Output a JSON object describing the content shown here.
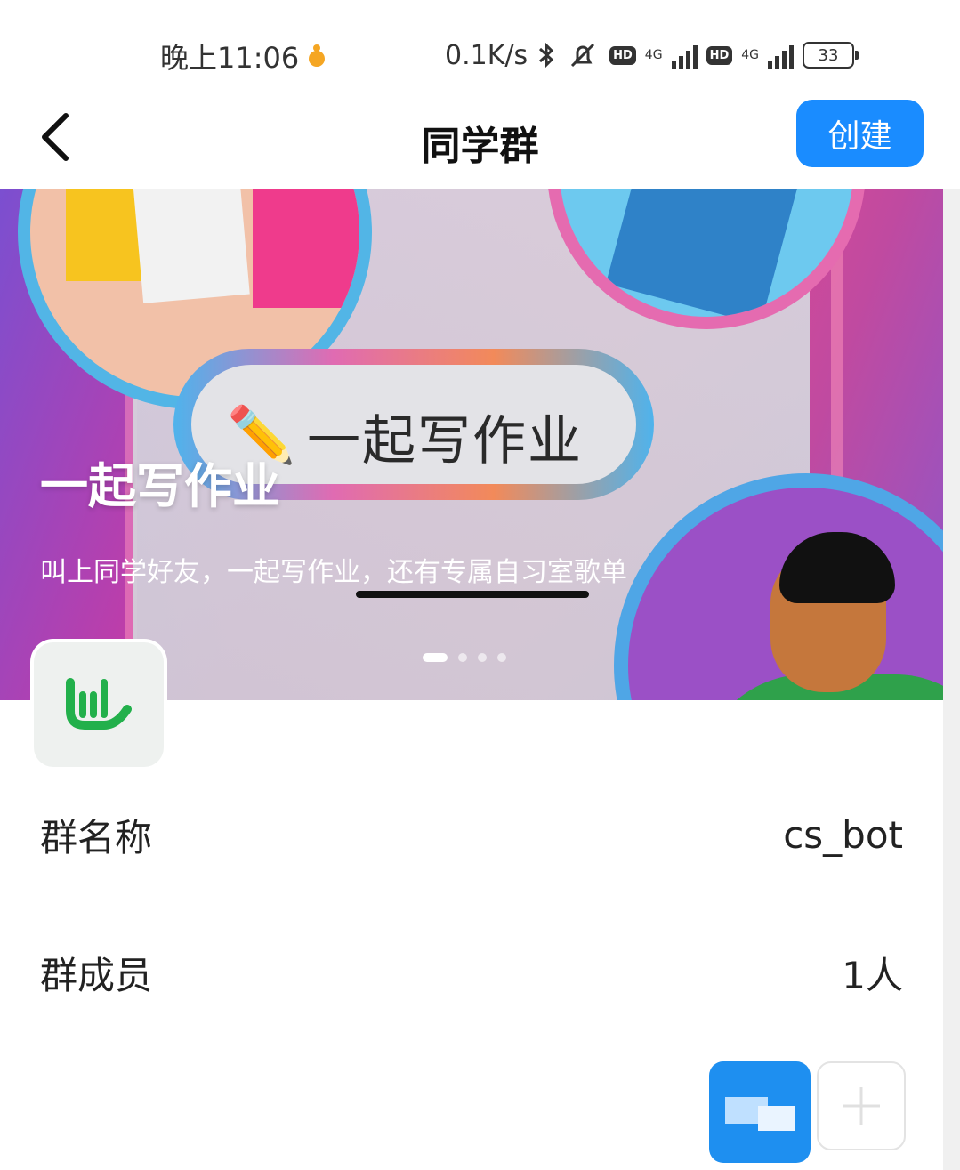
{
  "status_bar": {
    "time": "晚上11:06",
    "speed": "0.1K/s",
    "hd_label": "HD",
    "network": "4G",
    "battery": "33"
  },
  "header": {
    "title": "同学群",
    "create_label": "创建"
  },
  "banner": {
    "title": "一起写作业",
    "subtitle": "叫上同学好友，一起写作业，还有专属自习室歌单",
    "pill_text": "一起写作业",
    "dot_count": 4,
    "active_dot": 1
  },
  "group": {
    "name_label": "群名称",
    "name_value": "cs_bot",
    "members_label": "群成员",
    "members_value": "1人"
  },
  "colors": {
    "accent": "#1a8cff",
    "logo_green": "#22b04b"
  }
}
